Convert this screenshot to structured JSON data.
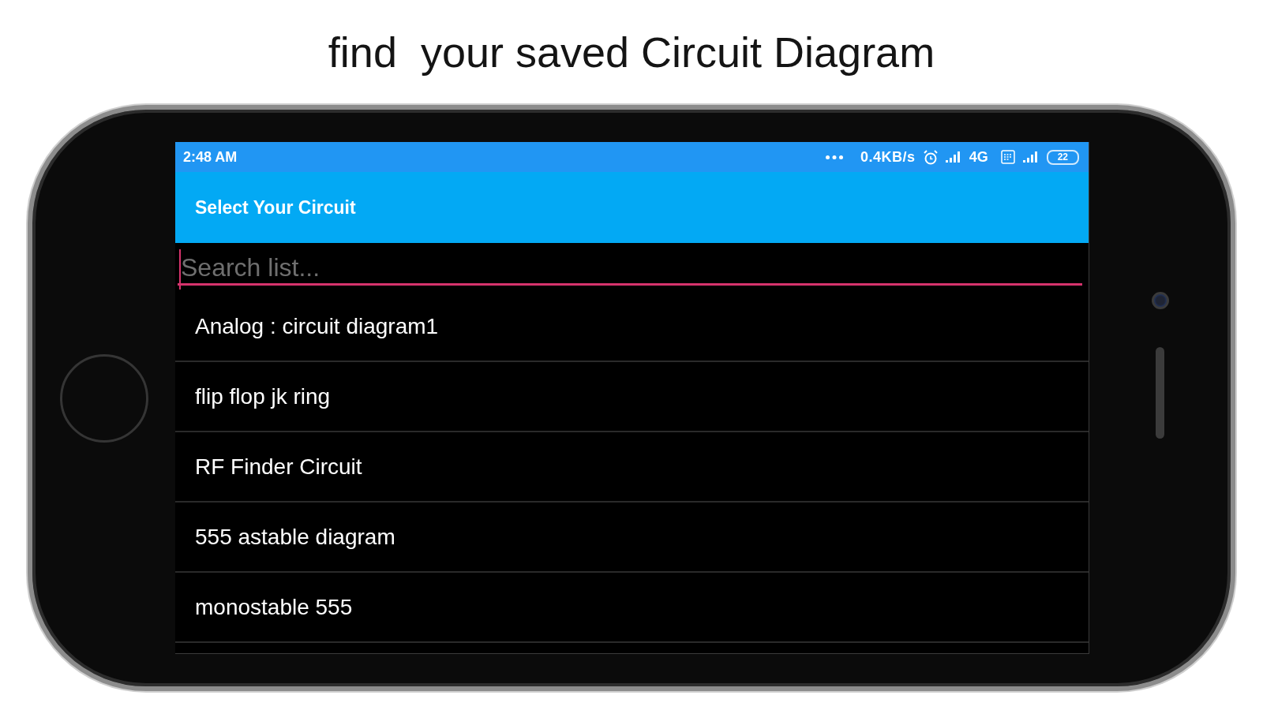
{
  "headline": "find  your saved Circuit Diagram",
  "status_bar": {
    "time": "2:48 AM",
    "network_speed": "0.4KB/s",
    "network_type": "4G",
    "battery": "22"
  },
  "app_bar": {
    "title": "Select Your Circuit"
  },
  "search": {
    "placeholder": "Search list...",
    "focused": true
  },
  "items": [
    {
      "label": "Analog : circuit diagram1"
    },
    {
      "label": "flip flop jk ring"
    },
    {
      "label": "RF Finder Circuit"
    },
    {
      "label": "555 astable diagram"
    },
    {
      "label": "monostable 555"
    }
  ]
}
